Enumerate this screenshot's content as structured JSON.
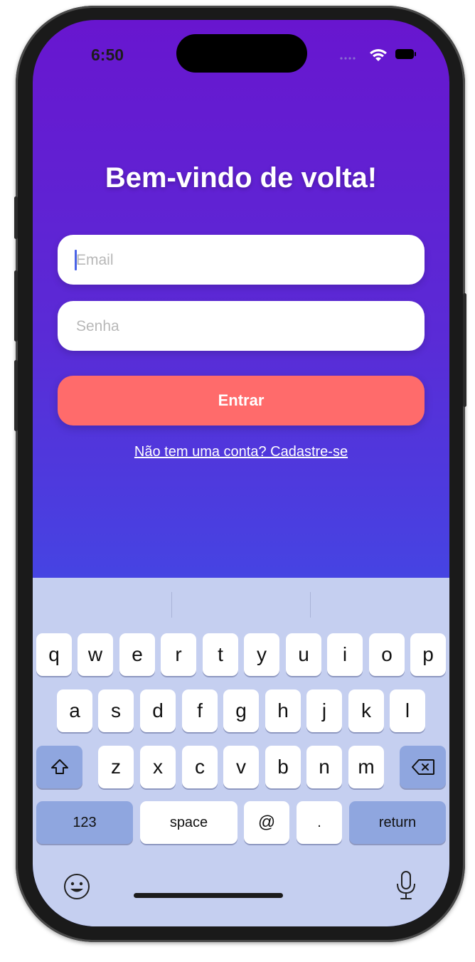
{
  "status": {
    "time": "6:50"
  },
  "login": {
    "title": "Bem-vindo de volta!",
    "email_placeholder": "Email",
    "password_placeholder": "Senha",
    "submit_label": "Entrar",
    "signup_link": "Não tem uma conta? Cadastre-se"
  },
  "keyboard": {
    "row1": [
      "q",
      "w",
      "e",
      "r",
      "t",
      "y",
      "u",
      "i",
      "o",
      "p"
    ],
    "row2": [
      "a",
      "s",
      "d",
      "f",
      "g",
      "h",
      "j",
      "k",
      "l"
    ],
    "row3": [
      "z",
      "x",
      "c",
      "v",
      "b",
      "n",
      "m"
    ],
    "numbers_label": "123",
    "space_label": "space",
    "at_label": "@",
    "dot_label": ".",
    "return_label": "return"
  },
  "colors": {
    "gradient_top": "#6816cf",
    "gradient_bottom": "#3d4fe8",
    "button": "#ff6b6b",
    "keyboard_bg": "#c5cff0"
  }
}
